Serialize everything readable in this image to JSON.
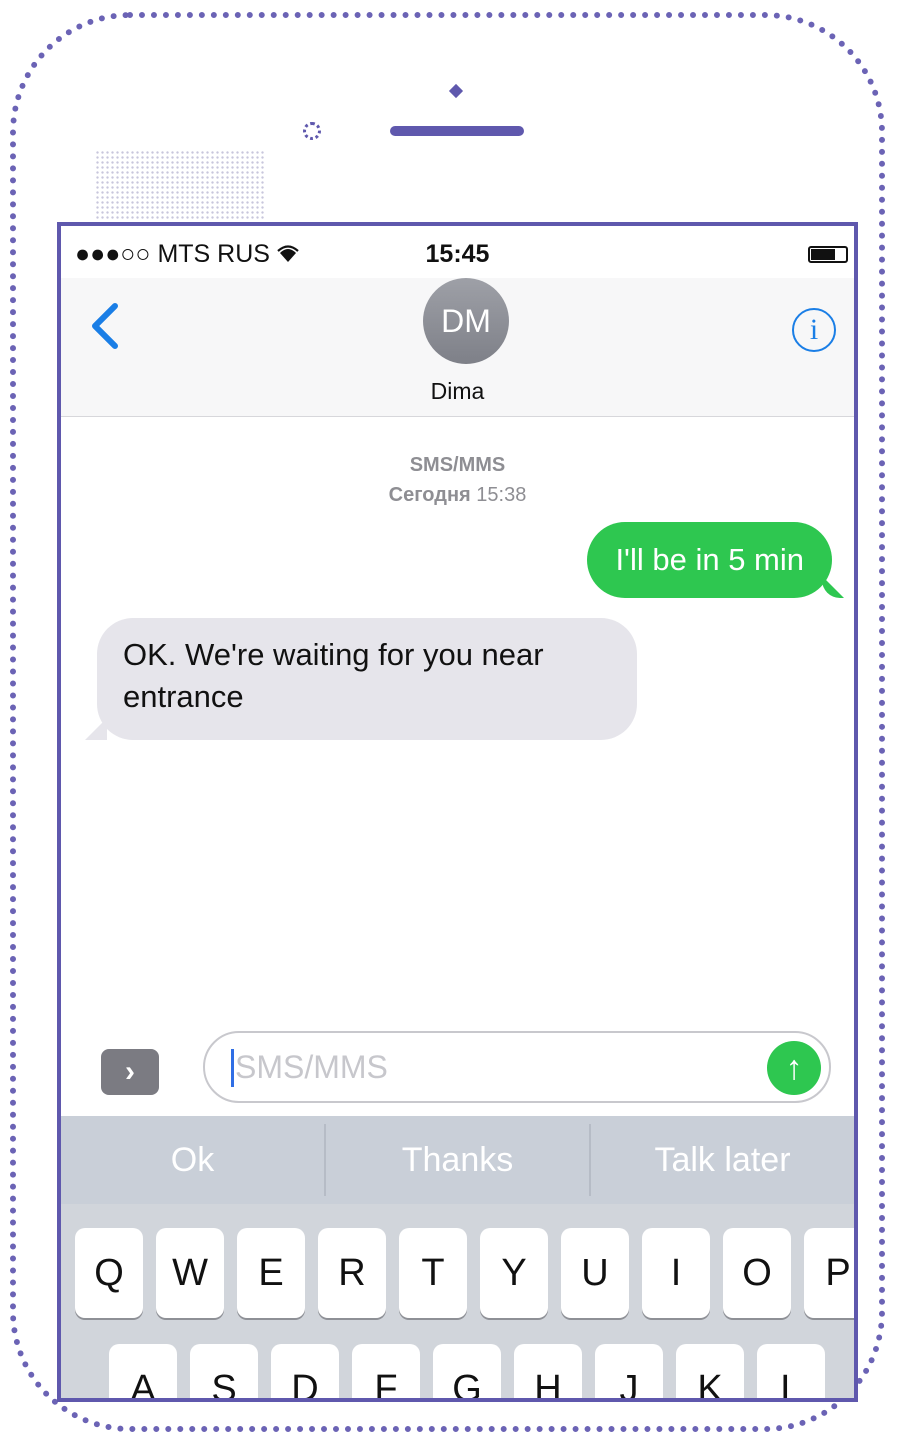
{
  "status_bar": {
    "carrier": "●●●○○ MTS RUS",
    "wifi_icon": "wifi-icon",
    "time": "15:45"
  },
  "header": {
    "back_icon": "chevron-left-icon",
    "avatar_initials": "DM",
    "contact_name": "Dima",
    "info_icon": "info-icon",
    "info_glyph": "i"
  },
  "thread": {
    "service": "SMS/MMS",
    "timestamp_day": "Сегодня",
    "timestamp_time": "15:38",
    "messages": [
      {
        "direction": "outgoing",
        "text": "I'll be in 5 min"
      },
      {
        "direction": "incoming",
        "text": " OK. We're waiting for you near entrance"
      }
    ]
  },
  "compose": {
    "apps_glyph": "›",
    "placeholder": "SMS/MMS",
    "send_glyph": "↑"
  },
  "suggestions": [
    "Ok",
    "Thanks",
    "Talk later"
  ],
  "keyboard": {
    "row1": [
      "Q",
      "W",
      "E",
      "R",
      "T",
      "Y",
      "U",
      "I",
      "O",
      "P"
    ],
    "row2": [
      "A",
      "S",
      "D",
      "F",
      "G",
      "H",
      "J",
      "K",
      "L"
    ]
  },
  "colors": {
    "accent_blue": "#1a7ee6",
    "imessage_green": "#2ec750",
    "incoming_bubble": "#e6e5eb",
    "outline": "#5f58ad"
  }
}
